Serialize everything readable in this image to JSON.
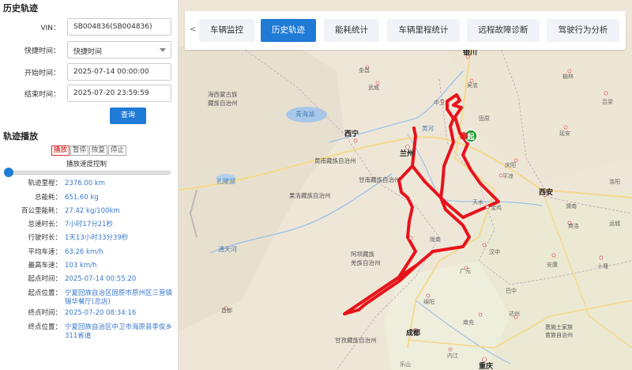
{
  "sidebar": {
    "title": "历史轨迹",
    "vin_label": "VIN：",
    "vin_value": "SB004836(SB004836)",
    "quick_time_label": "快捷时间：",
    "quick_time_value": "快捷时间",
    "start_label": "开始时间：",
    "start_value": "2025-07-14 00:00:00",
    "end_label": "结束时间：",
    "end_value": "2025-07-20 23:59:59",
    "query_button": "查询",
    "playback_title": "轨迹播放",
    "play_buttons": [
      "播放",
      "暂停",
      "恢复",
      "停止"
    ],
    "speed_label": "播放速度控制",
    "slider_level": 0,
    "info": [
      {
        "k": "轨迹里程：",
        "v": "2376.00 km"
      },
      {
        "k": "总能耗：",
        "v": "651.60 kg"
      },
      {
        "k": "百公里能耗：",
        "v": "27.42 kg/100km"
      },
      {
        "k": "怠速时长：",
        "v": "7小时17分21秒"
      },
      {
        "k": "行驶时长：",
        "v": "1天13小时33分39秒"
      },
      {
        "k": "平均车速：",
        "v": "63.26 km/h"
      },
      {
        "k": "最高车速：",
        "v": "103 km/h"
      },
      {
        "k": "起点时间：",
        "v": "2025-07-14 00:55:20"
      },
      {
        "k": "起点位置：",
        "v": "宁夏回族自治区固原市原州区三营镇锦华餐厅(总店)"
      },
      {
        "k": "终点时间：",
        "v": "2025-07-20 08:34:16"
      },
      {
        "k": "终点位置：",
        "v": "宁夏回族自治区中卫市海原县李俊乡311省道"
      }
    ]
  },
  "tabs": {
    "prev_arrow": "<",
    "items": [
      "车辆监控",
      "历史轨迹",
      "能耗统计",
      "车辆里程统计",
      "远程故障诊断",
      "驾驶行为分析"
    ],
    "active": 1
  },
  "map": {
    "start_marker": "起",
    "labels": [
      {
        "t": "银川"
      },
      {
        "t": "吴忠"
      },
      {
        "t": "中卫"
      },
      {
        "t": "海西蒙古族"
      },
      {
        "t": "藏族自治州"
      },
      {
        "t": "青海湖"
      },
      {
        "t": "西宁"
      },
      {
        "t": "兰州"
      },
      {
        "t": "黄河"
      },
      {
        "t": "黄南藏族自治州"
      },
      {
        "t": "甘南藏族自治州"
      },
      {
        "t": "扎陵湖"
      },
      {
        "t": "果洛藏族自治州"
      },
      {
        "t": "西安"
      },
      {
        "t": "天水"
      },
      {
        "t": "宝鸡"
      },
      {
        "t": "汉中"
      },
      {
        "t": "陇南"
      },
      {
        "t": "阿坝藏族"
      },
      {
        "t": "羌族自治州"
      },
      {
        "t": "广元"
      },
      {
        "t": "通天河"
      },
      {
        "t": "绵阳"
      },
      {
        "t": "成都"
      },
      {
        "t": "甘孜藏族自治州"
      },
      {
        "t": "南充"
      },
      {
        "t": "达州"
      },
      {
        "t": "内江"
      },
      {
        "t": "重庆"
      },
      {
        "t": "乐山"
      },
      {
        "t": "安康"
      },
      {
        "t": "商洛"
      },
      {
        "t": "十堰"
      },
      {
        "t": "延安"
      },
      {
        "t": "榆林"
      },
      {
        "t": "庆阳"
      },
      {
        "t": "平凉"
      },
      {
        "t": "固原"
      },
      {
        "t": "武威"
      },
      {
        "t": "金昌"
      },
      {
        "t": "渭南"
      },
      {
        "t": "巴中"
      },
      {
        "t": "恩施土家族"
      },
      {
        "t": "苗族自治州"
      },
      {
        "t": "昌都"
      },
      {
        "t": "石嘴山"
      },
      {
        "t": "吕梁"
      },
      {
        "t": "运城"
      },
      {
        "t": "洛阳"
      }
    ]
  }
}
